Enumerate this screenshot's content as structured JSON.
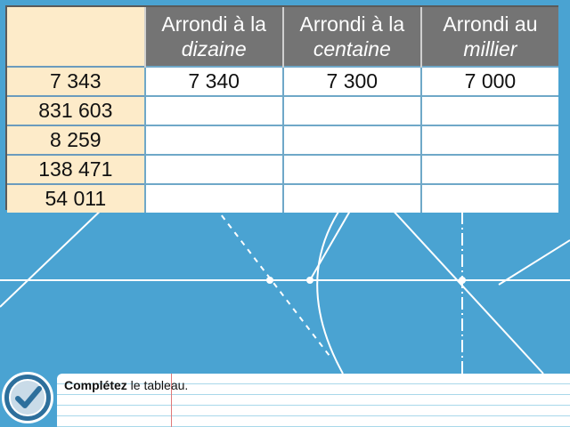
{
  "table": {
    "headers": [
      {
        "line1": "Arrondi à la",
        "line2": "dizaine"
      },
      {
        "line1": "Arrondi à la",
        "line2": "centaine"
      },
      {
        "line1": "Arrondi au",
        "line2": "millier"
      }
    ],
    "rows": [
      {
        "number": "7 343",
        "dizaine": "7 340",
        "centaine": "7 300",
        "millier": "7 000"
      },
      {
        "number": "831 603",
        "dizaine": "",
        "centaine": "",
        "millier": ""
      },
      {
        "number": "8 259",
        "dizaine": "",
        "centaine": "",
        "millier": ""
      },
      {
        "number": "138 471",
        "dizaine": "",
        "centaine": "",
        "millier": ""
      },
      {
        "number": "54 011",
        "dizaine": "",
        "centaine": "",
        "millier": ""
      }
    ]
  },
  "footer": {
    "instruction_bold": "Complétez",
    "instruction_rest": " le tableau.",
    "check_icon": "checkmark-icon"
  },
  "colors": {
    "background": "#4aa3d2",
    "header": "#747474",
    "number_column": "#fdebc9"
  }
}
